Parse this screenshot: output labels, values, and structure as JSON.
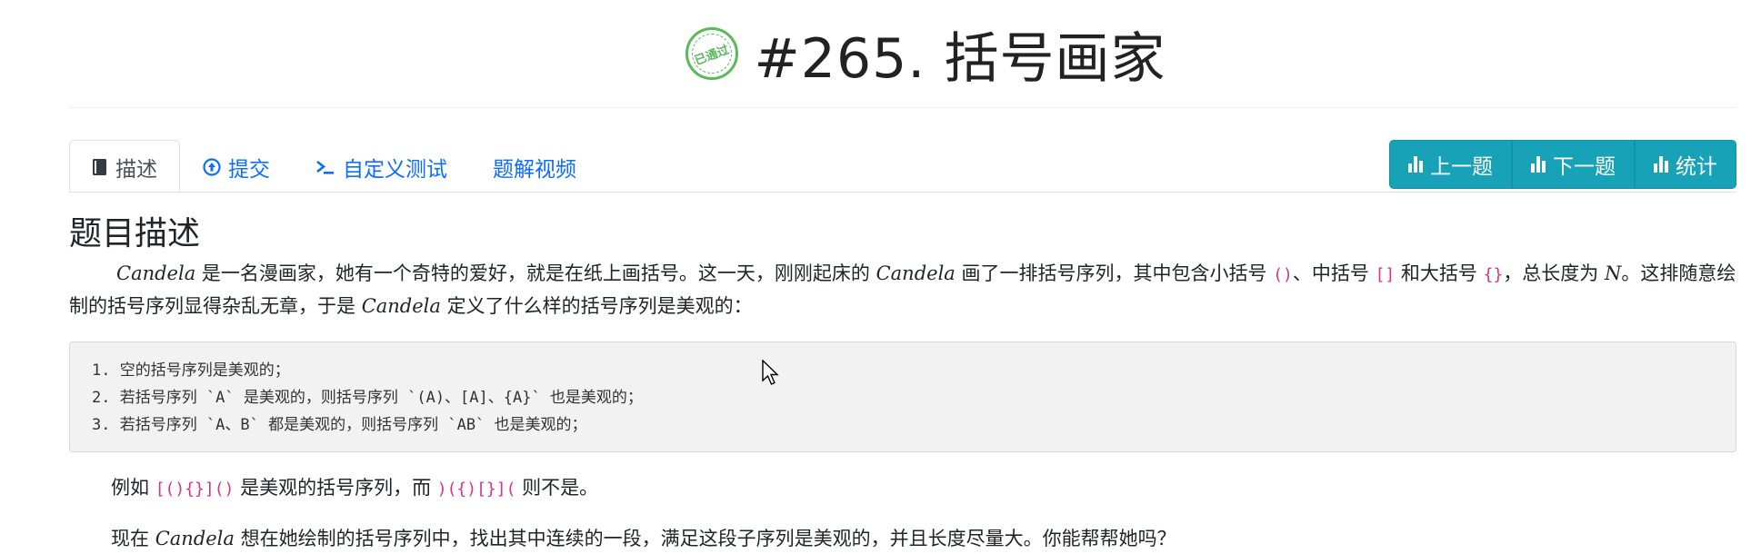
{
  "header": {
    "stamp_text": "已通过",
    "title": "#265. 括号画家"
  },
  "tabs": [
    {
      "label": "描述",
      "icon": "book-icon",
      "active": true
    },
    {
      "label": "提交",
      "icon": "upload-circle-icon",
      "active": false
    },
    {
      "label": "自定义测试",
      "icon": "terminal-icon",
      "active": false
    },
    {
      "label": "题解视频",
      "icon": "",
      "active": false
    }
  ],
  "actions": [
    {
      "label": "上一题",
      "icon": "bar-chart-icon"
    },
    {
      "label": "下一题",
      "icon": "bar-chart-icon"
    },
    {
      "label": "统计",
      "icon": "bar-chart-icon"
    }
  ],
  "content": {
    "section_title": "题目描述",
    "intro": {
      "name": "Candela",
      "t1": " 是一名漫画家，她有一个奇特的爱好，就是在纸上画括号。这一天，刚刚起床的 ",
      "t2": " 画了一排括号序列，其中包含小括号 ",
      "code1": "()",
      "t3": "、中括号 ",
      "code2": "[]",
      "t4": " 和大括号 ",
      "code3": "{}",
      "t5": "，总长度为 ",
      "var_n": "N",
      "t6": "。这排随意绘制的括号序列显得杂乱无章，于是 ",
      "t7": " 定义了什么样的括号序列是美观的："
    },
    "rules": [
      "1. 空的括号序列是美观的；",
      "2. 若括号序列 `A` 是美观的，则括号序列 `(A)、[A]、{A}` 也是美观的；",
      "3. 若括号序列 `A、B` 都是美观的，则括号序列 `AB` 也是美观的；"
    ],
    "example": {
      "t1": "例如 ",
      "code_good": "[(){}]()",
      "t2": " 是美观的括号序列，而 ",
      "code_bad": ")({)[}](",
      "t3": " 则不是。"
    },
    "question": {
      "t1": "现在 ",
      "name": "Candela",
      "t2": " 想在她绘制的括号序列中，找出其中连续的一段，满足这段子序列是美观的，并且长度尽量大。你能帮帮她吗？"
    }
  },
  "colors": {
    "link": "#0d6efd",
    "button": "#17a2b8",
    "code": "#d63384",
    "stamp": "#5cb85c"
  }
}
